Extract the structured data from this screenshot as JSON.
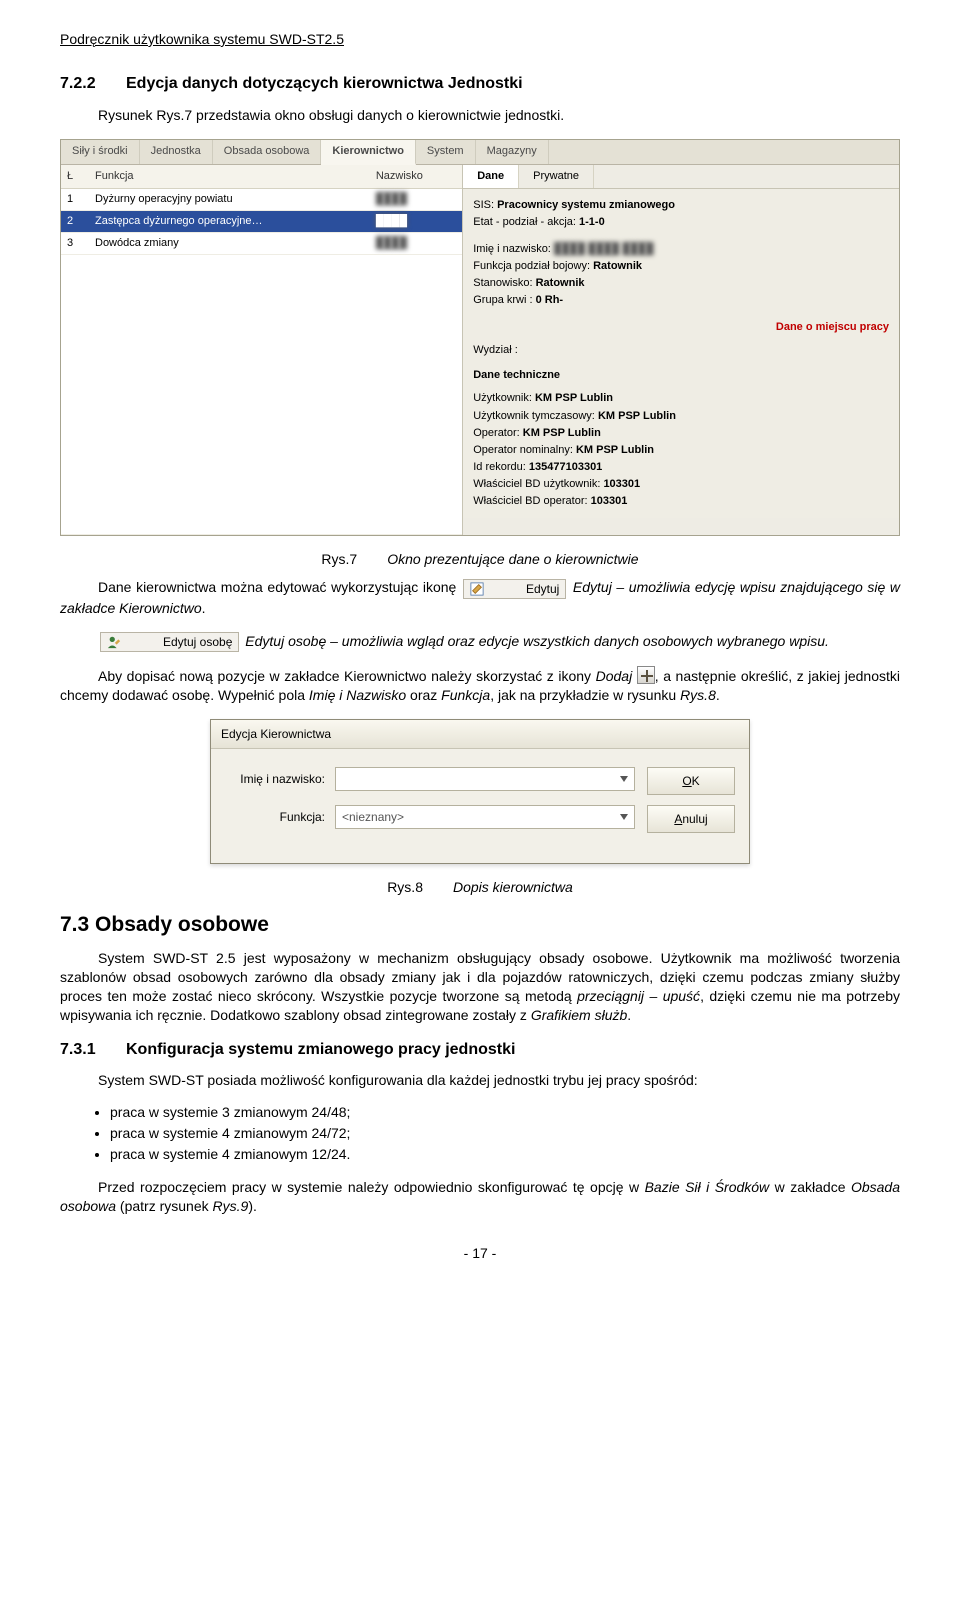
{
  "header": "Podręcznik użytkownika systemu SWD-ST2.5",
  "sec722": {
    "num": "7.2.2",
    "title": "Edycja danych dotyczących kierownictwa Jednostki"
  },
  "intro722": "Rysunek Rys.7 przedstawia okno obsługi danych o kierownictwie jednostki.",
  "shot1": {
    "tabs": [
      "Siły i środki",
      "Jednostka",
      "Obsada osobowa",
      "Kierownictwo",
      "System",
      "Magazyny"
    ],
    "activeTab": "Kierownictwo",
    "cols": [
      "Ł",
      "Funkcja",
      "Nazwisko"
    ],
    "rows": [
      {
        "l": "1",
        "funkcja": "Dyżurny operacyjny powiatu",
        "nazw": "████"
      },
      {
        "l": "2",
        "funkcja": "Zastępca dyżurnego operacyjne…",
        "nazw": "████"
      },
      {
        "l": "3",
        "funkcja": "Dowódca zmiany",
        "nazw": "████"
      }
    ],
    "subtabs": [
      "Dane",
      "Prywatne"
    ],
    "activeSubtab": "Dane",
    "details": {
      "sis_label": "SIS:",
      "sis": "Pracownicy systemu zmianowego",
      "etat_label": "Etat - podział - akcja:",
      "etat": "1-1-0",
      "imie_label": "Imię i nazwisko:",
      "imie": "████ ████ ████",
      "funkcja_label": "Funkcja podział bojowy:",
      "funkcja": "Ratownik",
      "stan_label": "Stanowisko:",
      "stan": "Ratownik",
      "krew_label": "Grupa krwi :",
      "krew": "0 Rh-",
      "hdr_miejsce": "Dane o miejscu pracy",
      "wydzial_label": "Wydział :",
      "wydzial": "",
      "hdr_tech": "Dane techniczne",
      "uz_label": "Użytkownik:",
      "uz": "KM PSP Lublin",
      "uzt_label": "Użytkownik tymczasowy:",
      "uzt": "KM PSP Lublin",
      "op_label": "Operator:",
      "op": "KM PSP Lublin",
      "opn_label": "Operator nominalny:",
      "opn": "KM PSP Lublin",
      "idrek_label": "Id rekordu:",
      "idrek": "135477103301",
      "wbd_label": "Właściciel BD użytkownik:",
      "wbd": "103301",
      "wbdop_label": "Właściciel BD operator:",
      "wbdop": "103301"
    }
  },
  "fig7": {
    "n": "Rys.7",
    "cap": "Okno prezentujące dane o kierownictwie"
  },
  "para_edit_a": "Dane kierownictwa można edytować wykorzystując ikonę ",
  "btn_edytuj": "Edytuj",
  "para_edit_b": " Edytuj – umożliwia edycję wpisu znajdującego się w zakładce ",
  "para_edit_c": "Kierownictwo",
  "para_edit_dot": ".",
  "btn_edytuj_osobe": "Edytuj osobę",
  "para_osoba_a": "Edytuj osobę – umożliwia wgląd oraz edycje wszystkich danych osobowych wybranego wpisu.",
  "para_dodaj_a": "Aby dopisać nową pozycje w zakładce Kierownictwo należy skorzystać z ikony ",
  "para_dodaj_b": "Dodaj",
  "para_dodaj_c": ", a następnie określić, z jakiej jednostki chcemy dodawać osobę. Wypełnić pola ",
  "para_dodaj_d": "Imię i Nazwisko",
  "para_dodaj_e": " oraz ",
  "para_dodaj_f": "Funkcja",
  "para_dodaj_g": ", jak na przykładzie w rysunku ",
  "para_dodaj_h": "Rys.8",
  "para_dodaj_i": ".",
  "shot2": {
    "title": "Edycja Kierownictwa",
    "lbl_name": "Imię i nazwisko:",
    "lbl_fn": "Funkcja:",
    "val_fn": "<nieznany>",
    "ok": "OK",
    "ok_key": "O",
    "cancel": "Anuluj",
    "cancel_key": "A"
  },
  "fig8": {
    "n": "Rys.8",
    "cap": "Dopis kierownictwa"
  },
  "sec73": {
    "title": "7.3 Obsady osobowe"
  },
  "para73": "System SWD-ST 2.5 jest wyposażony w mechanizm obsługujący obsady osobowe. Użytkownik ma możliwość tworzenia szablonów obsad osobowych zarówno dla obsady zmiany jak i dla pojazdów ratowniczych, dzięki czemu podczas zmiany służby proces ten może zostać nieco skrócony. Wszystkie pozycje tworzone są metodą ",
  "para73b": "przeciągnij – upuść",
  "para73c": ", dzięki czemu nie ma potrzeby wpisywania ich ręcznie. Dodatkowo szablony obsad zintegrowane zostały z ",
  "para73d": "Grafikiem służb",
  "para73e": ".",
  "sec731": {
    "num": "7.3.1",
    "title": "Konfiguracja systemu zmianowego pracy jednostki"
  },
  "para731": "System SWD-ST posiada możliwość konfigurowania dla każdej jednostki trybu jej pracy spośród:",
  "bullets": [
    "praca w systemie 3 zmianowym 24/48;",
    "praca w systemie 4 zmianowym 24/72;",
    "praca w systemie 4 zmianowym 12/24."
  ],
  "para_post_a": "Przed rozpoczęciem pracy w systemie należy odpowiednio skonfigurować tę opcję w ",
  "para_post_b": "Bazie Sił i Środków",
  "para_post_c": " w zakładce ",
  "para_post_d": "Obsada osobowa",
  "para_post_e": " (patrz rysunek ",
  "para_post_f": "Rys.9",
  "para_post_g": ").",
  "page": "- 17 -"
}
